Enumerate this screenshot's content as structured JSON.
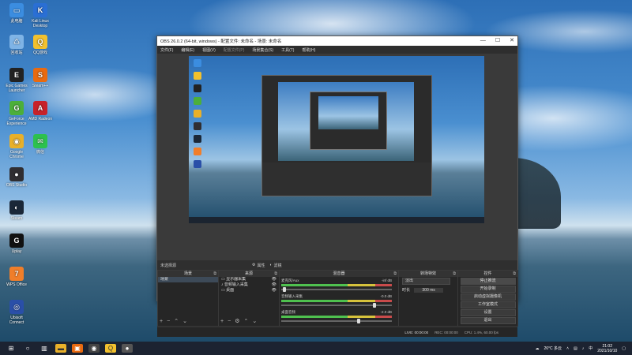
{
  "desktop": {
    "icons": [
      {
        "label": "此电脑",
        "name": "this-pc-icon",
        "color": "#3b8de0",
        "glyph": "▭"
      },
      {
        "label": "Kali Linux Desktop",
        "name": "kali-icon",
        "color": "#2a6fd4",
        "glyph": "K"
      },
      {
        "label": "回收站",
        "name": "recycle-bin-icon",
        "color": "#7fb4e6",
        "glyph": "♺"
      },
      {
        "label": "QQ游戏",
        "name": "qq-game-icon",
        "color": "#f2c12e",
        "glyph": "Q"
      },
      {
        "label": "Epic Games Launcher",
        "name": "epic-icon",
        "color": "#222222",
        "glyph": "E"
      },
      {
        "label": "Steam++",
        "name": "steam-plus-icon",
        "color": "#e86a10",
        "glyph": "S"
      },
      {
        "label": "GeForce Experience",
        "name": "geforce-icon",
        "color": "#4caf3a",
        "glyph": "G"
      },
      {
        "label": "AMD Radeon",
        "name": "amd-icon",
        "color": "#c7222a",
        "glyph": "A"
      },
      {
        "label": "Google Chrome",
        "name": "chrome-icon",
        "color": "#e8b02a",
        "glyph": "◉"
      },
      {
        "label": "微信",
        "name": "wechat-icon",
        "color": "#2dc14e",
        "glyph": "✉"
      },
      {
        "label": "OBS Studio",
        "name": "obs-desktop-icon",
        "color": "#302e31",
        "glyph": "●"
      },
      {
        "label": "Steam",
        "name": "steam-icon",
        "color": "#1b2838",
        "glyph": "◐"
      },
      {
        "label": "Uplay",
        "name": "uplay-icon",
        "color": "#111111",
        "glyph": "G"
      },
      {
        "label": "WPS Office",
        "name": "wps-icon",
        "color": "#f07e2a",
        "glyph": "7"
      },
      {
        "label": "Ubisoft Connect",
        "name": "ubisoft-icon",
        "color": "#2a4fa8",
        "glyph": "◎"
      }
    ]
  },
  "obs": {
    "title": "OBS 26.0.2 (64-bit, windows) - 配置文件: 未命名 - 场景: 未命名",
    "window_controls": [
      "—",
      "☐",
      "✕"
    ],
    "menu": [
      "文件(F)",
      "编辑(E)",
      "视图(V)",
      "配置文件(P)",
      "场景集合(S)",
      "工具(T)",
      "帮助(H)"
    ],
    "source_bar": {
      "selected": "未选择源",
      "properties": "属性",
      "filters": "滤镜"
    },
    "docks": {
      "scenes": {
        "title": "场景",
        "items": [
          "场景"
        ]
      },
      "sources": {
        "title": "来源",
        "items": [
          "显示器采集",
          "音频输入采集",
          "桌面"
        ]
      },
      "mixer": {
        "title": "混音器",
        "channels": [
          {
            "name": "麦克风/Aux",
            "db": "-inf dB"
          },
          {
            "name": "音频输入采集",
            "db": "-0.0 dB"
          },
          {
            "name": "桌面音频",
            "db": "-2.0 dB"
          }
        ]
      },
      "transitions": {
        "title": "转场特效",
        "type": "淡出",
        "duration_label": "时长",
        "duration": "300 ms"
      },
      "controls": {
        "title": "控件",
        "buttons": [
          "停止推流",
          "开始录制",
          "启动虚拟摄像机",
          "工作室模式",
          "设置",
          "退出"
        ]
      }
    },
    "status": {
      "live": "LIVE: 00:00:00",
      "rec": "REC: 00:00:00",
      "cpu": "CPU: 1.4%, 60.00 fps"
    }
  },
  "taskbar": {
    "weather": "26°C 多云",
    "time": "21:02",
    "date": "2021/10/10"
  }
}
